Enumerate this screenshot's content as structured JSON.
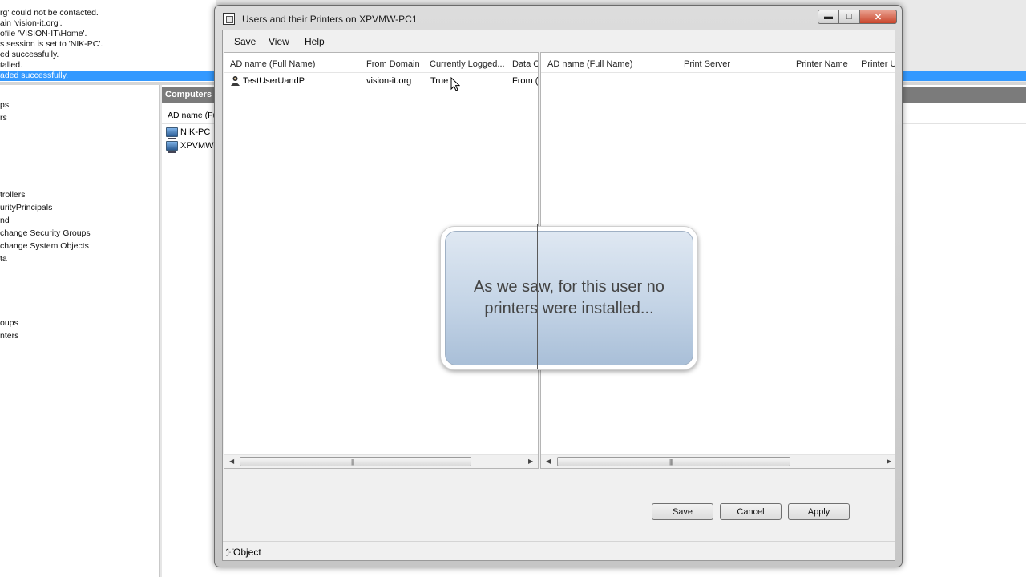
{
  "background": {
    "log_lines": [
      "rg' could not be contacted.",
      "ain 'vision-it.org'.",
      "ofile 'VISION-IT\\Home'.",
      "s session is set to 'NIK-PC'.",
      "ed successfully.",
      "talled.",
      "aded successfully."
    ],
    "tree_items": [
      "ps",
      "rs",
      "trollers",
      "urityPrincipals",
      "nd",
      "change Security Groups",
      "change System Objects",
      "ta",
      "oups",
      "nters"
    ],
    "computers_header": "Computers",
    "computers_column": "AD name (Fu",
    "computers": [
      "NIK-PC",
      "XPVMW-"
    ]
  },
  "dialog": {
    "title": "Users and their Printers on XPVMW-PC1",
    "menu": [
      "Save",
      "View",
      "Help"
    ],
    "window_buttons": {
      "minimize": "▬",
      "maximize": "□",
      "close": "✕"
    },
    "users_pane": {
      "columns": [
        "AD name (Full Name)",
        "From Domain",
        "Currently Logged...",
        "Data C"
      ],
      "rows": [
        {
          "name": "TestUserUandP",
          "domain": "vision-it.org",
          "logged": "True",
          "data": "From (r"
        }
      ]
    },
    "printers_pane": {
      "columns": [
        "AD name (Full Name)",
        "Print Server",
        "Printer Name",
        "Printer UI"
      ],
      "rows": []
    },
    "buttons": {
      "save": "Save",
      "cancel": "Cancel",
      "apply": "Apply"
    },
    "status": "1 Object"
  },
  "callout": {
    "text": "As we saw, for this user no printers were installed..."
  },
  "colors": {
    "selection": "#3399ff",
    "header_gray": "#7b7b7b",
    "close_button": "#c9452b"
  }
}
